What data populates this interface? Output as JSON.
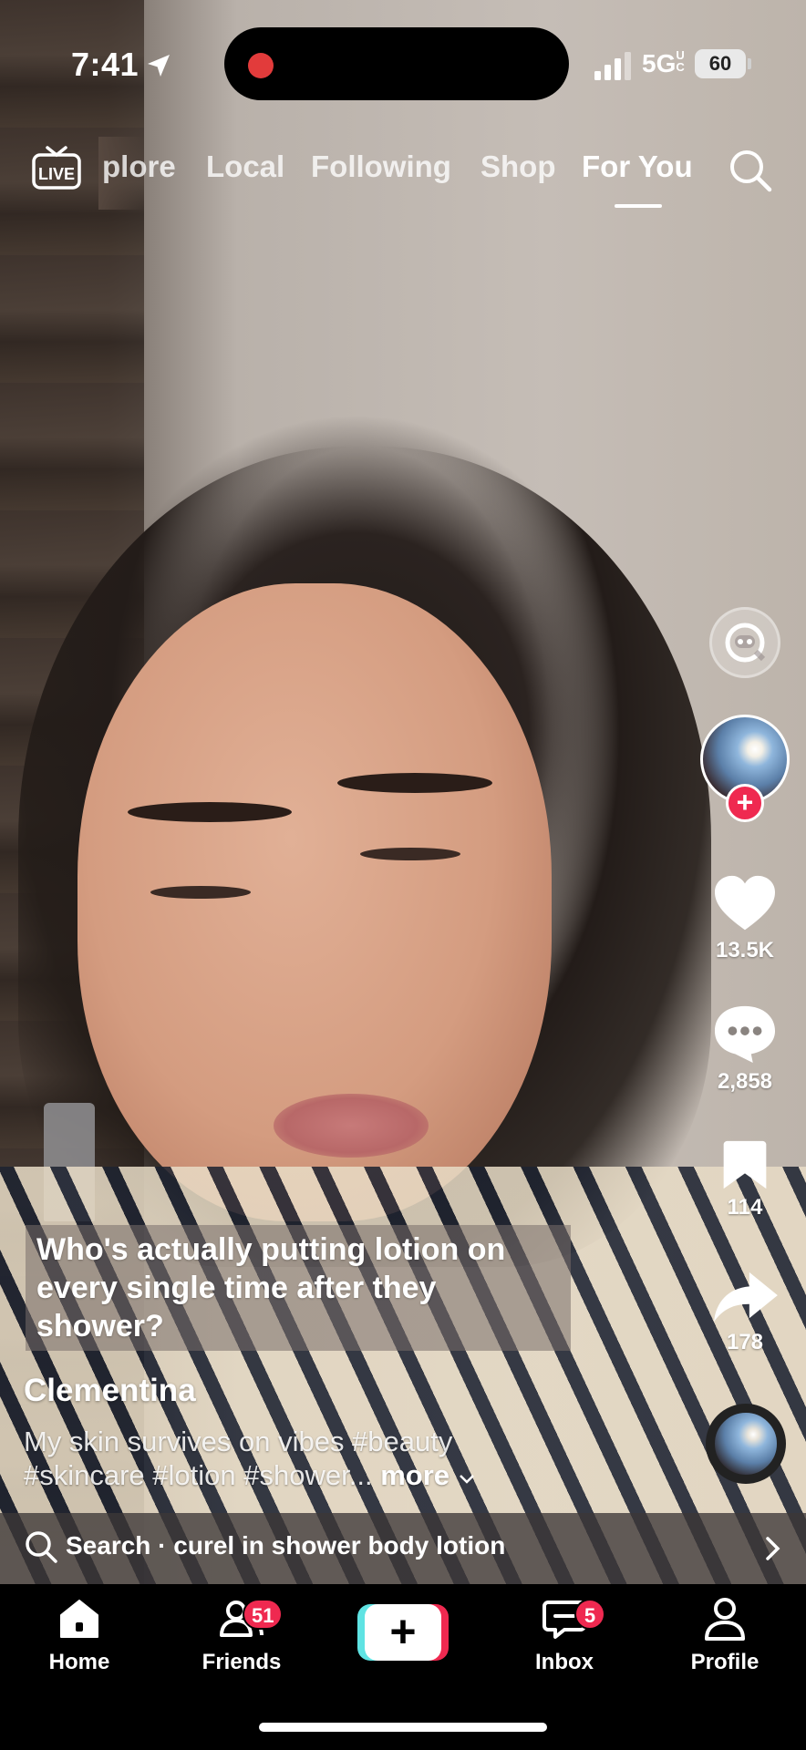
{
  "status_bar": {
    "time": "7:41",
    "network": "5G",
    "network_suffix": "UC",
    "battery": "60"
  },
  "top_nav": {
    "tabs": [
      {
        "label": "plore",
        "active": false
      },
      {
        "label": "Local",
        "active": false
      },
      {
        "label": "Following",
        "active": false
      },
      {
        "label": "Shop",
        "active": false
      },
      {
        "label": "For You",
        "active": true
      }
    ],
    "live_label": "LIVE"
  },
  "video": {
    "caption_lines": [
      "Who's actually putting lotion on",
      "every single time after they",
      "shower?"
    ],
    "username": "Clementina",
    "description_lines": [
      "My skin survives on vibes #beauty",
      "#skincare #lotion #shower..."
    ],
    "more_label": "more"
  },
  "actions": {
    "likes": "13.5K",
    "comments": "2,858",
    "saves": "114",
    "shares": "178"
  },
  "search_suggestion": {
    "text": "Search · curel in shower body lotion"
  },
  "tab_bar": {
    "home": "Home",
    "friends": "Friends",
    "friends_badge": "51",
    "inbox": "Inbox",
    "inbox_badge": "5",
    "profile": "Profile",
    "create_symbol": "+"
  },
  "colors": {
    "accent": "#ef2950",
    "create_cyan": "#5fe3e3"
  }
}
